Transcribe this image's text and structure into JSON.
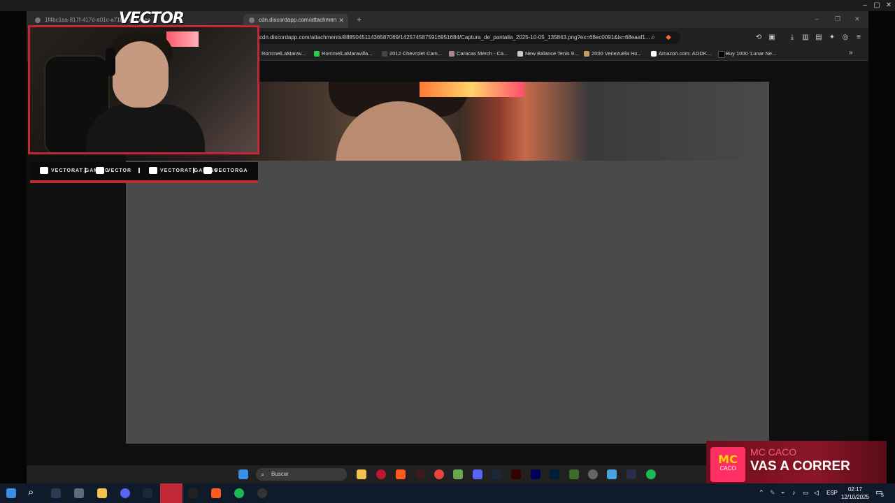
{
  "os": {
    "taskbar": {
      "clock_time": "02:17",
      "clock_date": "12/10/2025",
      "language": "ESP",
      "notification_count": "5"
    }
  },
  "browser": {
    "tabs": [
      {
        "label": "1f4bc1aa-817f-417d-a01c-a71b... er | Krea",
        "active": false
      },
      {
        "label": "cdn.discordapp.com/attachmen",
        "active": true
      }
    ],
    "new_tab": "+",
    "url": "cdn.discordapp.com/attachments/888504511436587069/1425745875916951684/Captura_de_pantalla_2025-10-05_135843.png?ex=68ec0091&is=68eaaf1...",
    "bookmarks": [
      "RommelLaMarav...",
      "RommelLaMaravilla...",
      "2012 Chevrolet Cam...",
      "Caracas Merch - Ca...",
      "New Balance Tenis 9...",
      "2000 Venezuela Ho...",
      "Amazon.com: AODK...",
      "Buy 1000 'Lunar Ne..."
    ],
    "bookmarks_more": "»"
  },
  "inner_taskbar": {
    "search_placeholder": "Buscar"
  },
  "stream_overlay": {
    "logo": "VECTOR",
    "social": [
      {
        "icon": "youtube-icon",
        "label": "VECTORAT GAMING"
      },
      {
        "icon": "twitch-icon",
        "label": "VECTOR"
      },
      {
        "icon": "twitter-icon",
        "label": "VECTORAT GAMING"
      },
      {
        "icon": "instagram-icon",
        "label": "VECTORGA"
      }
    ],
    "music": {
      "art_text": "MC",
      "art_subtext": "CACO",
      "artist": "MC CACO",
      "title": "VAS A CORRER"
    }
  },
  "colors": {
    "accent_red": "#c02838",
    "taskbar": "#0f1a2b",
    "music_bg": "#8a1626"
  }
}
